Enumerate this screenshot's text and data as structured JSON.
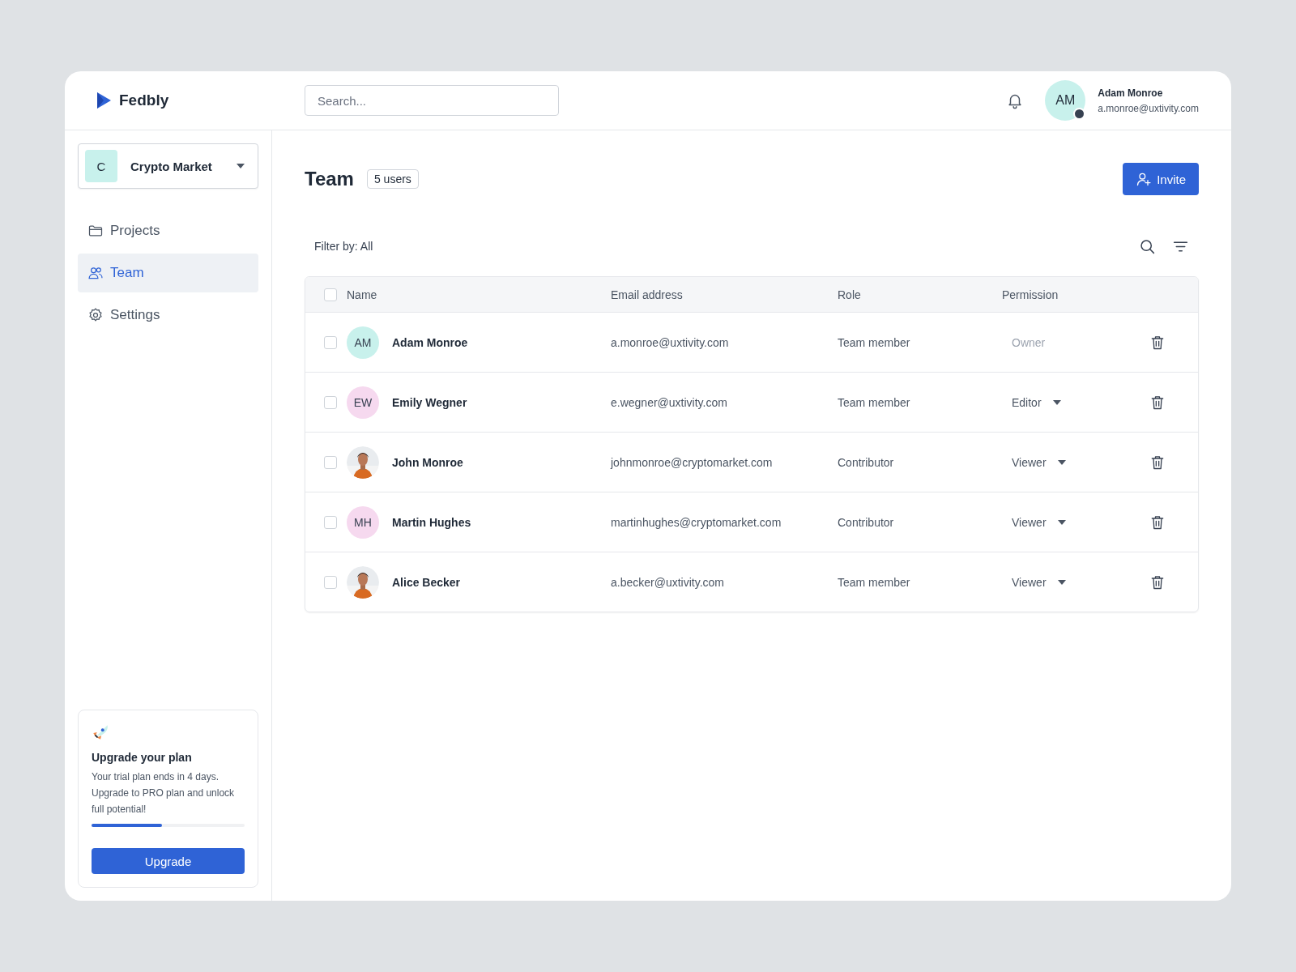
{
  "brand": {
    "name": "Fedbly"
  },
  "search": {
    "placeholder": "Search..."
  },
  "user": {
    "initials": "AM",
    "name": "Adam Monroe",
    "email": "a.monroe@uxtivity.com",
    "online": true
  },
  "workspace": {
    "initial": "C",
    "name": "Crypto Market"
  },
  "sidebar": {
    "items": [
      {
        "kind": "folder",
        "label": "Projects",
        "selected": false
      },
      {
        "kind": "team",
        "label": "Team",
        "selected": true
      },
      {
        "kind": "settings",
        "label": "Settings",
        "selected": false
      }
    ]
  },
  "page": {
    "title": "Team",
    "count": "5 users",
    "invite_button": "Invite",
    "filter": "Filter by: All"
  },
  "table": {
    "columns": [
      "Name",
      "Email address",
      "Role",
      "Permission"
    ],
    "all_checked": false,
    "rows": [
      {
        "checked": false,
        "avatar": {
          "kind": "initials",
          "text": "AM",
          "color": "#c8f1ec"
        },
        "name": "Adam Monroe",
        "email": "a.monroe@uxtivity.com",
        "role": "Team member",
        "permission": "Owner",
        "editable": false
      },
      {
        "checked": false,
        "avatar": {
          "kind": "initials",
          "text": "EW",
          "color": "#f6d9ef"
        },
        "name": "Emily Wegner",
        "email": "e.wegner@uxtivity.com",
        "role": "Team member",
        "permission": "Editor",
        "editable": true
      },
      {
        "checked": false,
        "name": "John Monroe",
        "email": "johnmonroe@cryptomarket.com",
        "role": "Contributor",
        "permission": "Viewer",
        "editable": true
      },
      {
        "checked": false,
        "avatar": {
          "kind": "initials",
          "text": "MH",
          "color": "#f6d9ef"
        },
        "name": "Martin Hughes",
        "email": "martinhughes@cryptomarket.com",
        "role": "Contributor",
        "permission": "Viewer",
        "editable": true
      },
      {
        "checked": false,
        "name": "Alice Becker",
        "email": "a.becker@uxtivity.com",
        "role": "Team member",
        "permission": "Viewer",
        "editable": true
      }
    ]
  },
  "upgrade_card": {
    "title": "Upgrade your plan",
    "text": "Your trial plan ends in 4 days. Upgrade to PRO plan and unlock full potential!",
    "level": 0.46,
    "button": "Upgrade"
  }
}
